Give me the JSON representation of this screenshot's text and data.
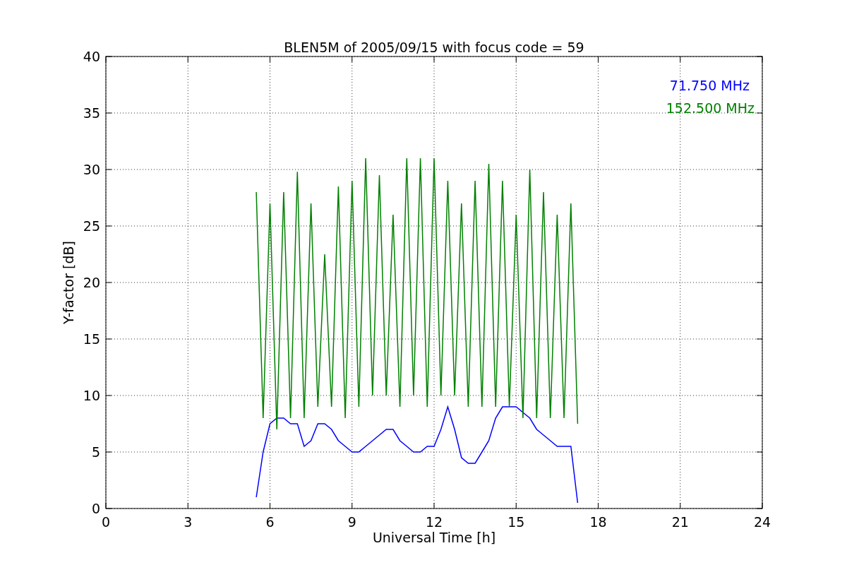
{
  "chart_data": {
    "type": "line",
    "title": "BLEN5M of 2005/09/15 with focus code = 59",
    "xlabel": "Universal Time [h]",
    "ylabel": "Y-factor [dB]",
    "xlim": [
      0,
      24
    ],
    "ylim": [
      0,
      40
    ],
    "xticks": [
      0,
      3,
      6,
      9,
      12,
      15,
      18,
      21,
      24
    ],
    "yticks": [
      0,
      5,
      10,
      15,
      20,
      25,
      30,
      35,
      40
    ],
    "grid": true,
    "x": [
      5.5,
      5.75,
      6,
      6.25,
      6.5,
      6.75,
      7,
      7.25,
      7.5,
      7.75,
      8,
      8.25,
      8.5,
      8.75,
      9,
      9.25,
      9.5,
      9.75,
      10,
      10.25,
      10.5,
      10.75,
      11,
      11.25,
      11.5,
      11.75,
      12,
      12.25,
      12.5,
      12.75,
      13,
      13.25,
      13.5,
      13.75,
      14,
      14.25,
      14.5,
      14.75,
      15,
      15.25,
      15.5,
      15.75,
      16,
      16.25,
      16.5,
      16.75,
      17,
      17.25
    ],
    "series": [
      {
        "name": "71.750 MHz",
        "color": "#0000ff",
        "values": [
          1,
          5,
          7.5,
          8,
          8,
          7.5,
          7.5,
          5.5,
          6,
          7.5,
          7.5,
          7,
          6,
          5.5,
          5,
          5,
          5.5,
          6,
          6.5,
          7,
          7,
          6,
          5.5,
          5,
          5,
          5.5,
          5.5,
          7,
          9,
          7,
          4.5,
          4,
          4,
          5,
          6,
          8,
          9,
          9,
          9,
          8.5,
          8,
          7,
          6.5,
          6,
          5.5,
          5.5,
          5.5,
          0.5
        ]
      },
      {
        "name": "152.500 MHz",
        "color": "#008000",
        "values": [
          28,
          8,
          27,
          7,
          28,
          8,
          29.8,
          8,
          27,
          9,
          22.5,
          9,
          28.5,
          8,
          29,
          9,
          31,
          10,
          29.5,
          10,
          26,
          9,
          31,
          10,
          31,
          9,
          31,
          10,
          29,
          10,
          27,
          9,
          29,
          9,
          30.5,
          9,
          29,
          9,
          26,
          8,
          30,
          8,
          28,
          8,
          26,
          8,
          27,
          7.5
        ]
      }
    ]
  }
}
